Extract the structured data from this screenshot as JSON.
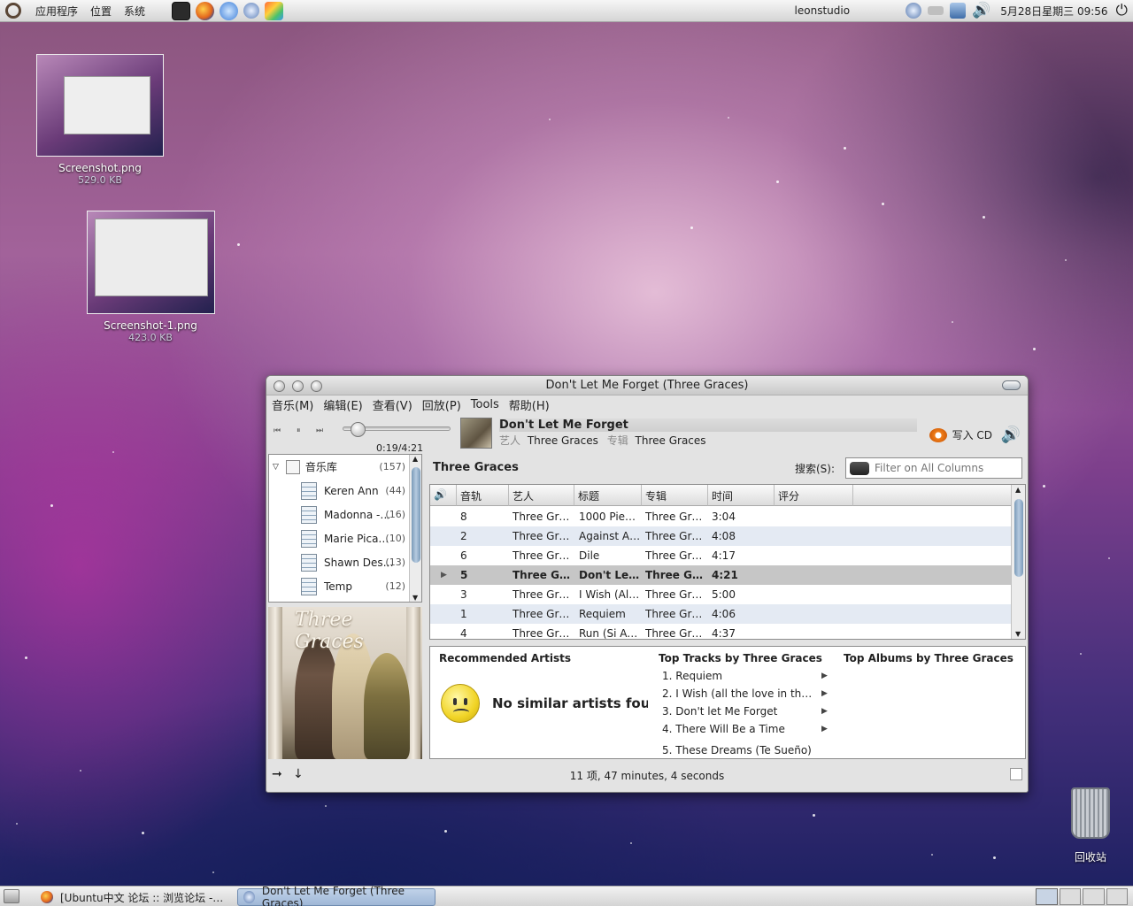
{
  "top_panel": {
    "menus": [
      "应用程序",
      "位置",
      "系统"
    ],
    "launchers": [
      "terminal-icon",
      "firefox-icon",
      "messenger-icon",
      "rhythmbox-icon",
      "paint-icon"
    ],
    "user": "leonstudio",
    "datetime": "5月28日星期三 09:56"
  },
  "desktop": {
    "icons": [
      {
        "name": "Screenshot.png",
        "size": "529.0 KB"
      },
      {
        "name": "Screenshot-1.png",
        "size": "423.0 KB"
      }
    ],
    "trash_label": "回收站"
  },
  "window": {
    "title": "Don't Let Me Forget (Three Graces)",
    "menu": [
      "音乐(M)",
      "编辑(E)",
      "查看(V)",
      "回放(P)",
      "Tools",
      "帮助(H)"
    ],
    "player": {
      "elapsed": "0:19/4:21",
      "progress": 0.073,
      "track_title": "Don't Let Me Forget",
      "artist_label": "艺人",
      "artist": "Three Graces",
      "album_label": "专辑",
      "album": "Three Graces",
      "burn_label": "写入 CD"
    },
    "sources": {
      "library": {
        "label": "音乐库",
        "count": "(157)"
      },
      "playlists": [
        {
          "label": "Keren Ann",
          "count": "(44)"
        },
        {
          "label": "Madonna -…",
          "count": "(16)"
        },
        {
          "label": "Marie Pica…",
          "count": "(10)"
        },
        {
          "label": "Shawn Des…",
          "count": "(13)"
        },
        {
          "label": "Temp",
          "count": "(12)"
        }
      ]
    },
    "cover_text": "Three Graces",
    "browser": {
      "artist_header": "Three Graces",
      "search_label": "搜索(S):",
      "search_placeholder": "Filter on All Columns"
    },
    "tracks": {
      "columns": [
        "音轨",
        "艺人",
        "标题",
        "专辑",
        "时间",
        "评分"
      ],
      "rows": [
        {
          "track": "8",
          "artist": "Three Gra…",
          "title": "1000 Pieces",
          "album": "Three Gra…",
          "time": "3:04"
        },
        {
          "track": "2",
          "artist": "Three Gra…",
          "title": "Against Al…",
          "album": "Three Gra…",
          "time": "4:08"
        },
        {
          "track": "6",
          "artist": "Three Gra…",
          "title": "Dile",
          "album": "Three Gra…",
          "time": "4:17"
        },
        {
          "track": "5",
          "artist": "Three Gr…",
          "title": "Don't Le…",
          "album": "Three Gr…",
          "time": "4:21",
          "playing": true
        },
        {
          "track": "3",
          "artist": "Three Gra…",
          "title": "I Wish (All…",
          "album": "Three Gra…",
          "time": "5:00"
        },
        {
          "track": "1",
          "artist": "Three Gra…",
          "title": "Requiem",
          "album": "Three Gra…",
          "time": "4:06"
        },
        {
          "track": "4",
          "artist": "Three Gra…",
          "title": "Run (Si Ac…",
          "album": "Three Gra…",
          "time": "4:37"
        }
      ]
    },
    "info": {
      "recommended_header": "Recommended Artists",
      "no_similar": "No similar artists found",
      "top_tracks_header": "Top Tracks by Three Graces",
      "top_tracks": [
        "1. Requiem",
        "2. I Wish (all the love in the W…",
        "3. Don't let Me Forget",
        "4. There Will Be a Time",
        "5. These Dreams (Te Sueño)"
      ],
      "top_albums_header": "Top Albums by Three Graces"
    },
    "status": "11 项, 47 minutes, 4 seconds"
  },
  "taskbar": {
    "tasks": [
      "[Ubuntu中文 论坛 :: 浏览论坛 -…",
      "Don't Let Me Forget (Three Graces)"
    ]
  }
}
